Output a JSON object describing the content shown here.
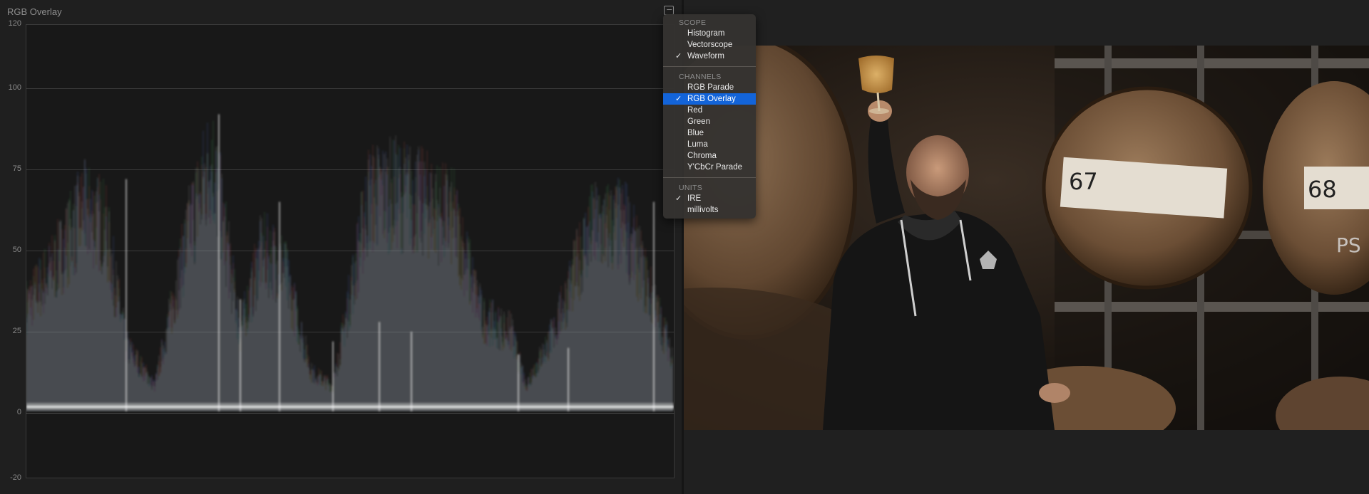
{
  "scope": {
    "title": "RGB Overlay",
    "settings_icon": "scope-settings-icon",
    "y_ticks": [
      "120",
      "100",
      "75",
      "50",
      "25",
      "0",
      "-20"
    ]
  },
  "menu": {
    "scope_header": "SCOPE",
    "scope_items": [
      {
        "label": "Histogram",
        "checked": false
      },
      {
        "label": "Vectorscope",
        "checked": false
      },
      {
        "label": "Waveform",
        "checked": true
      }
    ],
    "channels_header": "CHANNELS",
    "channel_items": [
      {
        "label": "RGB Parade",
        "checked": false
      },
      {
        "label": "RGB Overlay",
        "checked": true,
        "highlighted": true
      },
      {
        "label": "Red",
        "checked": false
      },
      {
        "label": "Green",
        "checked": false
      },
      {
        "label": "Blue",
        "checked": false
      },
      {
        "label": "Luma",
        "checked": false
      },
      {
        "label": "Chroma",
        "checked": false
      },
      {
        "label": "Y'CbCr Parade",
        "checked": false
      }
    ],
    "units_header": "UNITS",
    "unit_items": [
      {
        "label": "IRE",
        "checked": true
      },
      {
        "label": "millivolts",
        "checked": false
      }
    ],
    "check_glyph": "✓"
  },
  "viewer": {
    "barrel_labels": [
      "67",
      "68",
      "PS"
    ]
  },
  "colors": {
    "selection": "#1364d9",
    "background": "#1f1f1f"
  }
}
